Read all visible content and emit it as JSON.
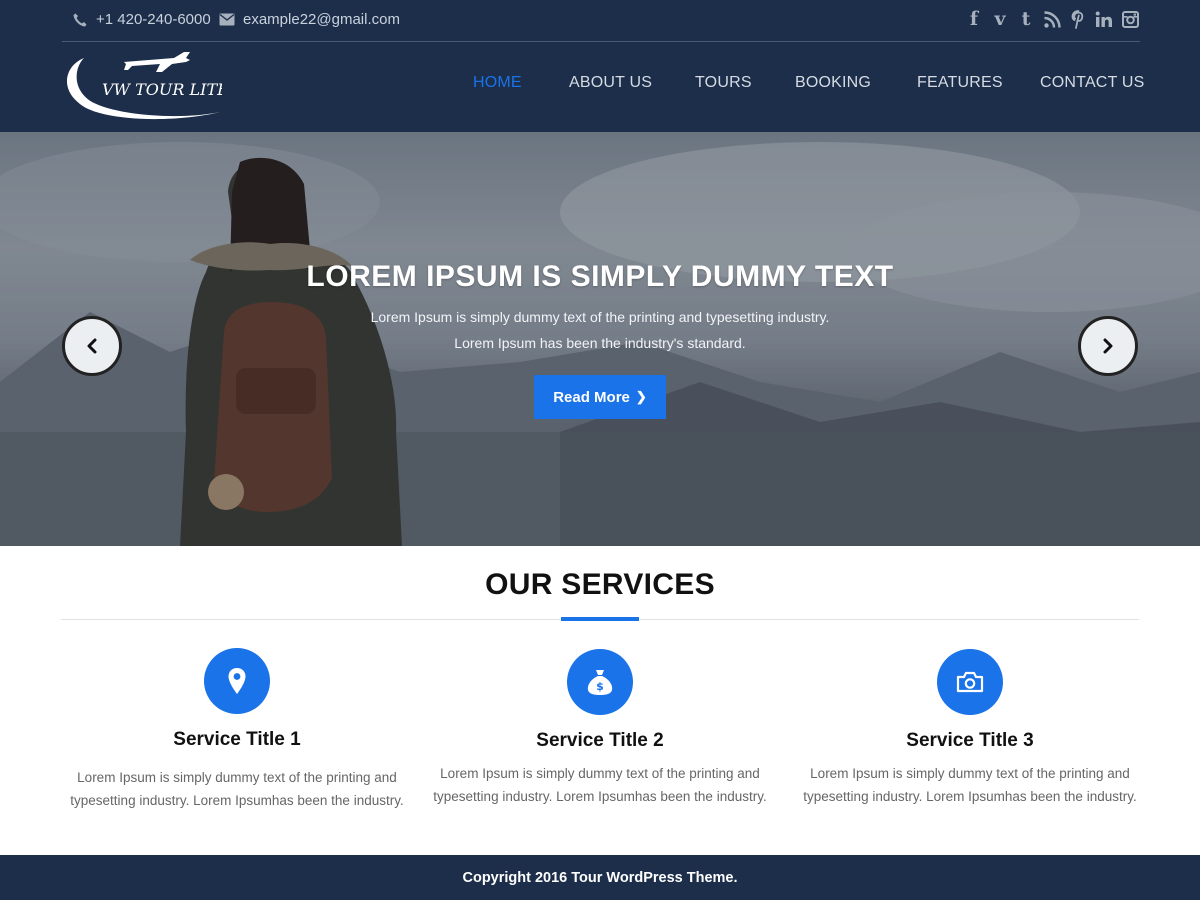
{
  "topbar": {
    "phone": "+1 420-240-6000",
    "email": "example22@gmail.com",
    "socials": [
      "facebook-icon",
      "vimeo-icon",
      "tumblr-icon",
      "rss-icon",
      "pinterest-icon",
      "linkedin-icon",
      "instagram-icon"
    ]
  },
  "logo": {
    "text": "VW TOUR LITE"
  },
  "nav": {
    "items": [
      {
        "label": "HOME",
        "active": true
      },
      {
        "label": "ABOUT US"
      },
      {
        "label": "TOURS"
      },
      {
        "label": "BOOKING"
      },
      {
        "label": "FEATURES"
      },
      {
        "label": "CONTACT US"
      }
    ]
  },
  "hero": {
    "title": "LOREM IPSUM IS SIMPLY DUMMY TEXT",
    "text": "Lorem Ipsum is simply dummy text of the printing and typesetting industry. Lorem Ipsum has been the industry's standard.",
    "button_label": "Read More"
  },
  "services": {
    "title": "OUR SERVICES",
    "items": [
      {
        "title": "Service Title 1",
        "text": "Lorem Ipsum is simply dummy text of the printing and typesetting industry. Lorem Ipsumhas been the industry.",
        "icon": "map-marker-icon"
      },
      {
        "title": "Service Title 2",
        "text": "Lorem Ipsum is simply dummy text of the printing and typesetting industry. Lorem Ipsumhas been the industry.",
        "icon": "money-bag-icon"
      },
      {
        "title": "Service Title 3",
        "text": "Lorem Ipsum is simply dummy text of the printing and typesetting industry. Lorem Ipsumhas been the industry.",
        "icon": "camera-icon"
      }
    ]
  },
  "footer": {
    "copyright": "Copyright 2016 Tour WordPress Theme."
  },
  "colors": {
    "navy": "#1c2e4a",
    "accent": "#1a73e8"
  }
}
